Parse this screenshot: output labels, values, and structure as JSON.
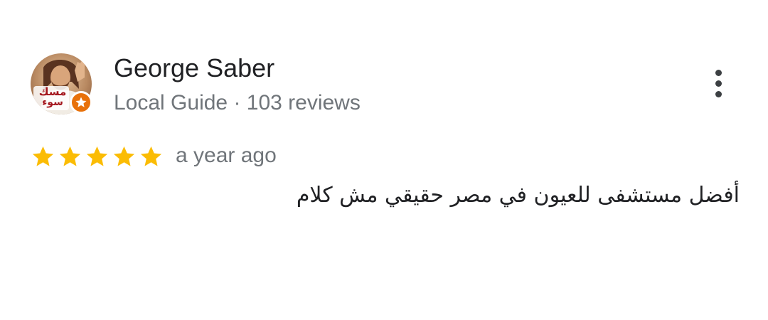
{
  "review": {
    "author": {
      "name": "George Saber",
      "subtitle": "Local Guide · 103 reviews",
      "avatar_text_line1": "مسك",
      "avatar_text_line2": "سوء"
    },
    "rating": {
      "stars": 5,
      "max_stars": 5,
      "star_color": "#fbbc04"
    },
    "date": "a year ago",
    "text": "أفضل مستشفى للعيون في مصر حقيقي مش كلام",
    "more_options_icon": "more-vert-icon"
  },
  "colors": {
    "name": "#202124",
    "secondary_text": "#70757a",
    "badge": "#e8710a"
  }
}
